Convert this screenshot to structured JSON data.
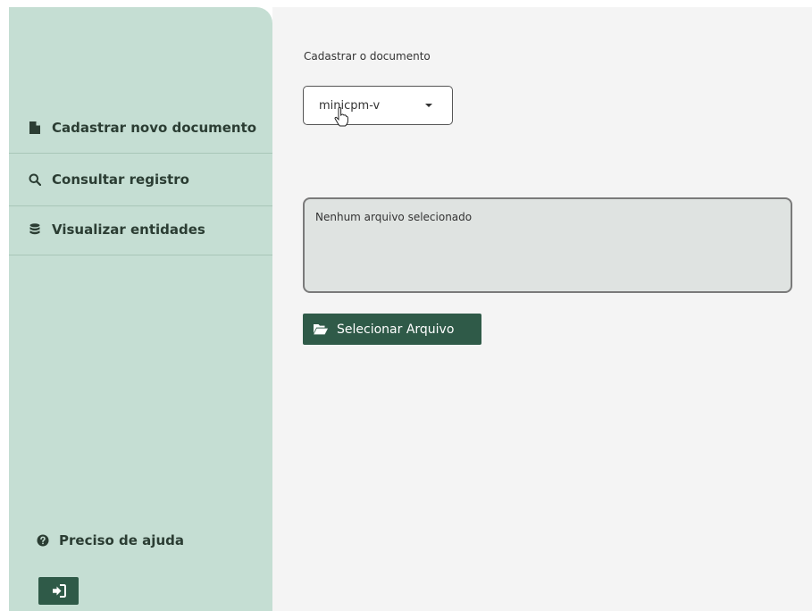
{
  "sidebar": {
    "items": [
      {
        "label": "Cadastrar novo documento",
        "icon": "file-icon"
      },
      {
        "label": "Consultar registro",
        "icon": "search-icon"
      },
      {
        "label": "Visualizar entidades",
        "icon": "database-icon"
      }
    ],
    "help_label": "Preciso de ajuda",
    "help_icon": "question-circle-icon",
    "logout_icon": "logout-icon"
  },
  "main": {
    "section_label": "Cadastrar o documento",
    "model_select": {
      "value": "minicpm-v"
    },
    "file_status": "Nenhum arquivo selecionado",
    "select_file_label": "Selecionar Arquivo",
    "select_file_icon": "folder-open-icon"
  },
  "colors": {
    "sidebar_bg": "#c5ded3",
    "main_bg": "#f4f4f4",
    "accent": "#2f5a48",
    "text": "#2b3d33"
  }
}
